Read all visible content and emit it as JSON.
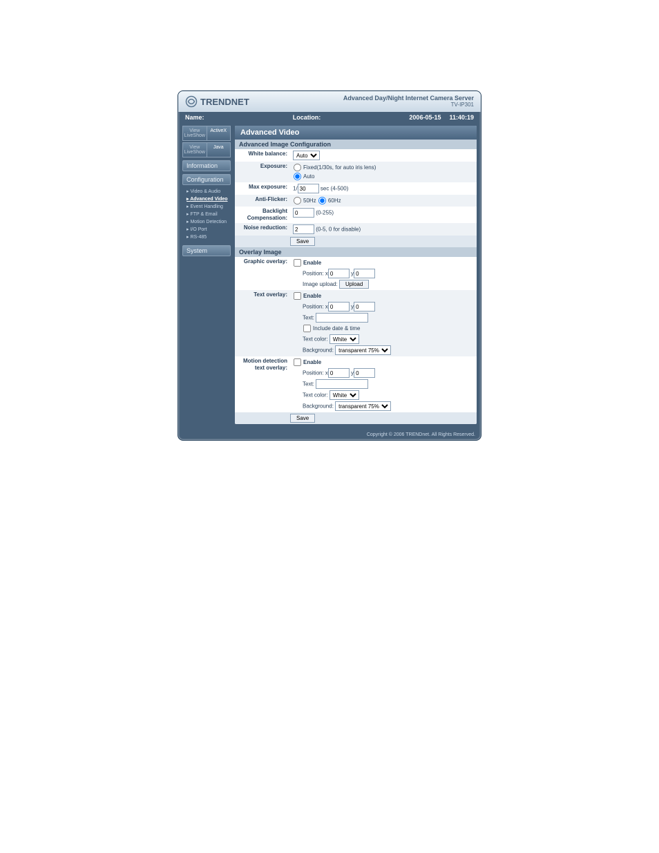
{
  "header": {
    "brand": "TRENDNET",
    "product_line1": "Advanced Day/Night Internet Camera Server",
    "product_line2": "TV-IP301"
  },
  "meta": {
    "name_label": "Name:",
    "location_label": "Location:",
    "date": "2006-05-15",
    "time": "11:40:19"
  },
  "sidebar": {
    "tabs1": {
      "a": "View LiveShow",
      "b": "ActiveX"
    },
    "tabs2": {
      "a": "View LiveShow",
      "b": "Java"
    },
    "information": "Information",
    "configuration": "Configuration",
    "links": [
      {
        "label": "Video & Audio",
        "active": false
      },
      {
        "label": "Advanced Video",
        "active": true
      },
      {
        "label": "Event Handling",
        "active": false
      },
      {
        "label": "FTP & Email",
        "active": false
      },
      {
        "label": "Motion Detection",
        "active": false
      },
      {
        "label": "I/O Port",
        "active": false
      },
      {
        "label": "RS-485",
        "active": false
      }
    ],
    "system": "System"
  },
  "panel": {
    "title": "Advanced Video",
    "section1": "Advanced Image Configuration",
    "white_balance": {
      "label": "White balance:",
      "value": "Auto"
    },
    "exposure": {
      "label": "Exposure:",
      "opt_fixed": "Fixed(1/30s, for auto iris lens)",
      "opt_auto": "Auto"
    },
    "max_exposure": {
      "label": "Max exposure:",
      "prefix": "1/",
      "value": "30",
      "suffix": " sec (4-500)"
    },
    "anti_flicker": {
      "label": "Anti-Flicker:",
      "opt50": "50Hz",
      "opt60": "60Hz"
    },
    "backlight": {
      "label": "Backlight Compensation:",
      "value": "0",
      "hint": "(0-255)"
    },
    "noise": {
      "label": "Noise reduction:",
      "value": "2",
      "hint": "(0-5, 0 for disable)"
    },
    "save": "Save",
    "section2": "Overlay Image",
    "graphic": {
      "label": "Graphic overlay:",
      "enable": "Enable",
      "pos_label": "Position: x",
      "x": "0",
      "y_label": " y",
      "y": "0",
      "upload_label": "Image upload:",
      "upload_btn": "Upload"
    },
    "text": {
      "label": "Text overlay:",
      "enable": "Enable",
      "pos_label": "Position: x",
      "x": "0",
      "y_label": " y",
      "y": "0",
      "text_label": "Text:",
      "text_value": "",
      "include": "Include date & time",
      "color_label": "Text color:",
      "color": "White",
      "bg_label": "Background:",
      "bg": "transparent 75%"
    },
    "motion": {
      "label": "Motion detection text overlay:",
      "enable": "Enable",
      "pos_label": "Position: x",
      "x": "0",
      "y_label": " y",
      "y": "0",
      "text_label": "Text:",
      "text_value": "",
      "color_label": "Text color:",
      "color": "White",
      "bg_label": "Background:",
      "bg": "transparent 75%"
    }
  },
  "copyright": "Copyright © 2006 TRENDnet. All Rights Reserved."
}
